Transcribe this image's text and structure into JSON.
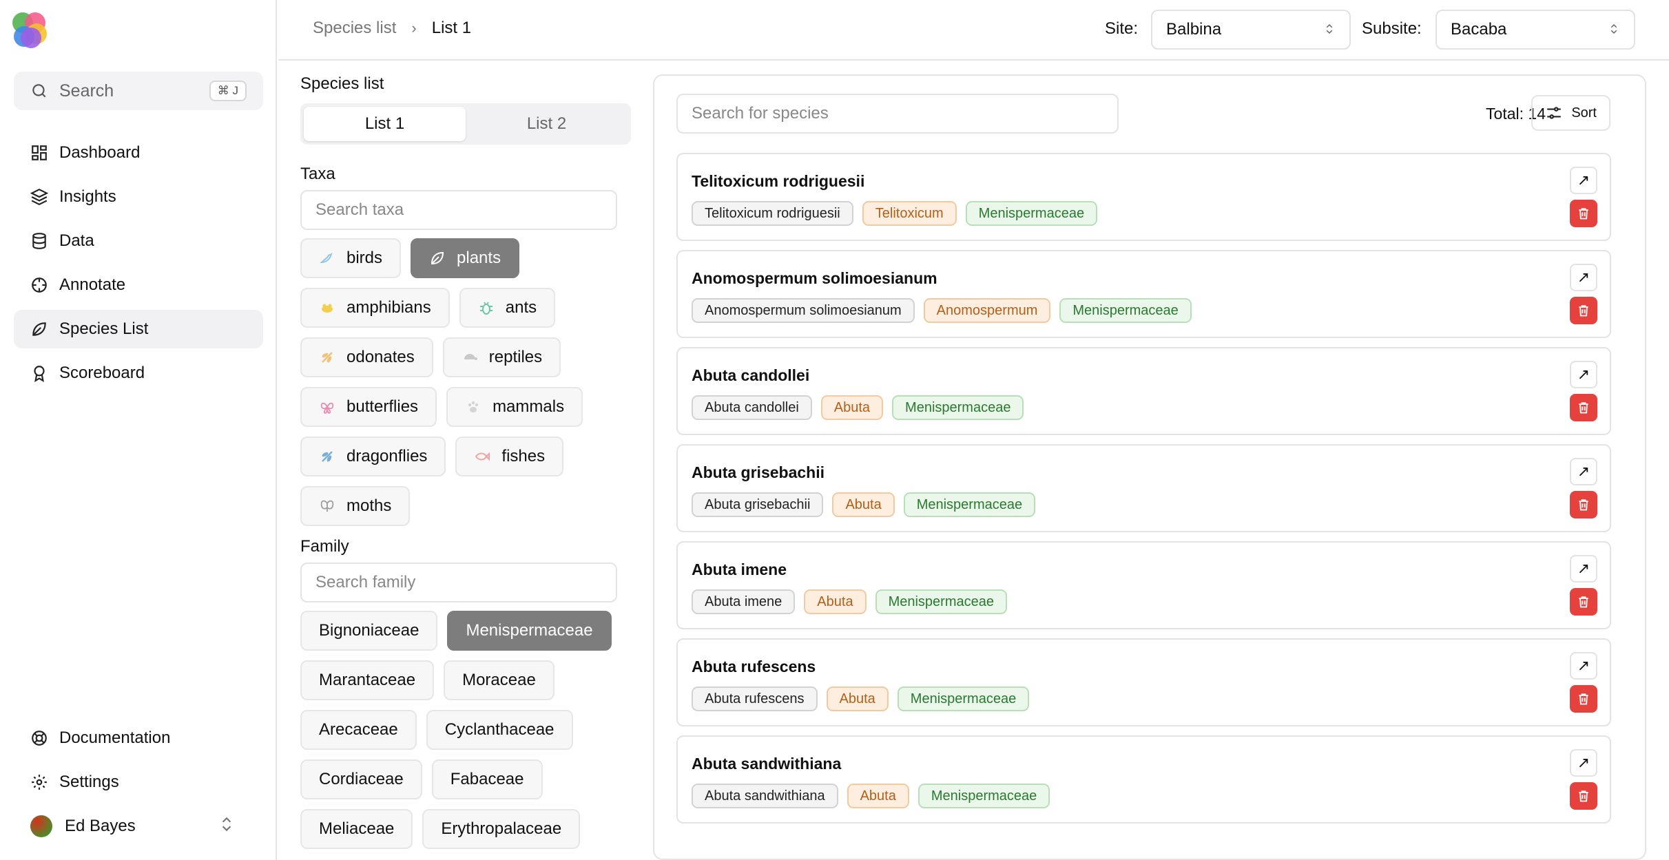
{
  "sidebar": {
    "search_label": "Search",
    "search_shortcut": "⌘ J",
    "nav": [
      {
        "label": "Dashboard",
        "icon": "dashboard-icon"
      },
      {
        "label": "Insights",
        "icon": "layers-icon"
      },
      {
        "label": "Data",
        "icon": "database-icon"
      },
      {
        "label": "Annotate",
        "icon": "crosshair-icon"
      },
      {
        "label": "Species List",
        "icon": "leaf-icon",
        "active": true
      },
      {
        "label": "Scoreboard",
        "icon": "award-icon"
      }
    ],
    "bottom": [
      {
        "label": "Documentation",
        "icon": "life-buoy-icon"
      },
      {
        "label": "Settings",
        "icon": "gear-icon"
      }
    ],
    "user": {
      "name": "Ed Bayes"
    }
  },
  "topbar": {
    "breadcrumb": [
      "Species list",
      "List 1"
    ],
    "site_label": "Site:",
    "site_value": "Balbina",
    "subsite_label": "Subsite:",
    "subsite_value": "Bacaba"
  },
  "filters": {
    "title": "Species list",
    "tabs": [
      {
        "label": "List 1",
        "active": true
      },
      {
        "label": "List 2",
        "active": false
      }
    ],
    "taxa_title": "Taxa",
    "taxa_placeholder": "Search taxa",
    "taxa": [
      {
        "label": "birds",
        "icon": "bird-icon",
        "color": "#8fc9e8",
        "selected": false
      },
      {
        "label": "plants",
        "icon": "leaf-icon",
        "color": "#ffffff",
        "selected": true
      },
      {
        "label": "amphibians",
        "icon": "frog-icon",
        "color": "#f2d04b",
        "selected": false
      },
      {
        "label": "ants",
        "icon": "bug-icon",
        "color": "#6cc9a6",
        "selected": false
      },
      {
        "label": "odonates",
        "icon": "dragonfly-icon",
        "color": "#f0c37a",
        "selected": false
      },
      {
        "label": "reptiles",
        "icon": "turtle-icon",
        "color": "#c9c9c9",
        "selected": false
      },
      {
        "label": "butterflies",
        "icon": "butterfly-icon",
        "color": "#e98bb2",
        "selected": false
      },
      {
        "label": "mammals",
        "icon": "paw-icon",
        "color": "#d4d4d4",
        "selected": false
      },
      {
        "label": "dragonflies",
        "icon": "dragonfly-icon",
        "color": "#7ab0d8",
        "selected": false
      },
      {
        "label": "fishes",
        "icon": "fish-icon",
        "color": "#f2a3a3",
        "selected": false
      },
      {
        "label": "moths",
        "icon": "moth-icon",
        "color": "#9c9c9c",
        "selected": false
      }
    ],
    "family_title": "Family",
    "family_placeholder": "Search family",
    "families": [
      {
        "label": "Bignoniaceae",
        "selected": false
      },
      {
        "label": "Menispermaceae",
        "selected": true
      },
      {
        "label": "Marantaceae",
        "selected": false
      },
      {
        "label": "Moraceae",
        "selected": false
      },
      {
        "label": "Arecaceae",
        "selected": false
      },
      {
        "label": "Cyclanthaceae",
        "selected": false
      },
      {
        "label": "Cordiaceae",
        "selected": false
      },
      {
        "label": "Fabaceae",
        "selected": false
      },
      {
        "label": "Meliaceae",
        "selected": false
      },
      {
        "label": "Erythropalaceae",
        "selected": false
      }
    ]
  },
  "results": {
    "search_placeholder": "Search for species",
    "total_text": "Total: 14",
    "sort_label": "Sort",
    "species": [
      {
        "name": "Telitoxicum rodriguesii",
        "species": "Telitoxicum rodriguesii",
        "genus": "Telitoxicum",
        "family": "Menispermaceae"
      },
      {
        "name": "Anomospermum solimoesianum",
        "species": "Anomospermum solimoesianum",
        "genus": "Anomospermum",
        "family": "Menispermaceae"
      },
      {
        "name": "Abuta candollei",
        "species": "Abuta candollei",
        "genus": "Abuta",
        "family": "Menispermaceae"
      },
      {
        "name": "Abuta grisebachii",
        "species": "Abuta grisebachii",
        "genus": "Abuta",
        "family": "Menispermaceae"
      },
      {
        "name": "Abuta imene",
        "species": "Abuta imene",
        "genus": "Abuta",
        "family": "Menispermaceae"
      },
      {
        "name": "Abuta rufescens",
        "species": "Abuta rufescens",
        "genus": "Abuta",
        "family": "Menispermaceae"
      },
      {
        "name": "Abuta sandwithiana",
        "species": "Abuta sandwithiana",
        "genus": "Abuta",
        "family": "Menispermaceae"
      }
    ]
  }
}
